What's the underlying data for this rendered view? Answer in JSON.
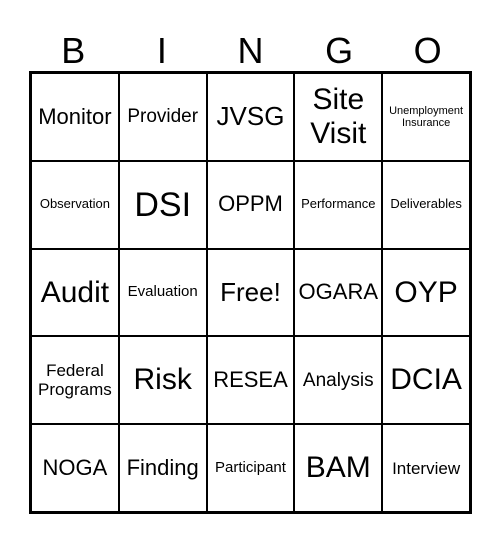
{
  "header": [
    "B",
    "I",
    "N",
    "G",
    "O"
  ],
  "cells": [
    [
      "Monitor",
      "Provider",
      "JVSG",
      "Site Visit",
      "Unemployment Insurance"
    ],
    [
      "Observation",
      "DSI",
      "OPPM",
      "Performance",
      "Deliverables"
    ],
    [
      "Audit",
      "Evaluation",
      "Free!",
      "OGARA",
      "OYP"
    ],
    [
      "Federal Programs",
      "Risk",
      "RESEA",
      "Analysis",
      "DCIA"
    ],
    [
      "NOGA",
      "Finding",
      "Participant",
      "BAM",
      "Interview"
    ]
  ]
}
